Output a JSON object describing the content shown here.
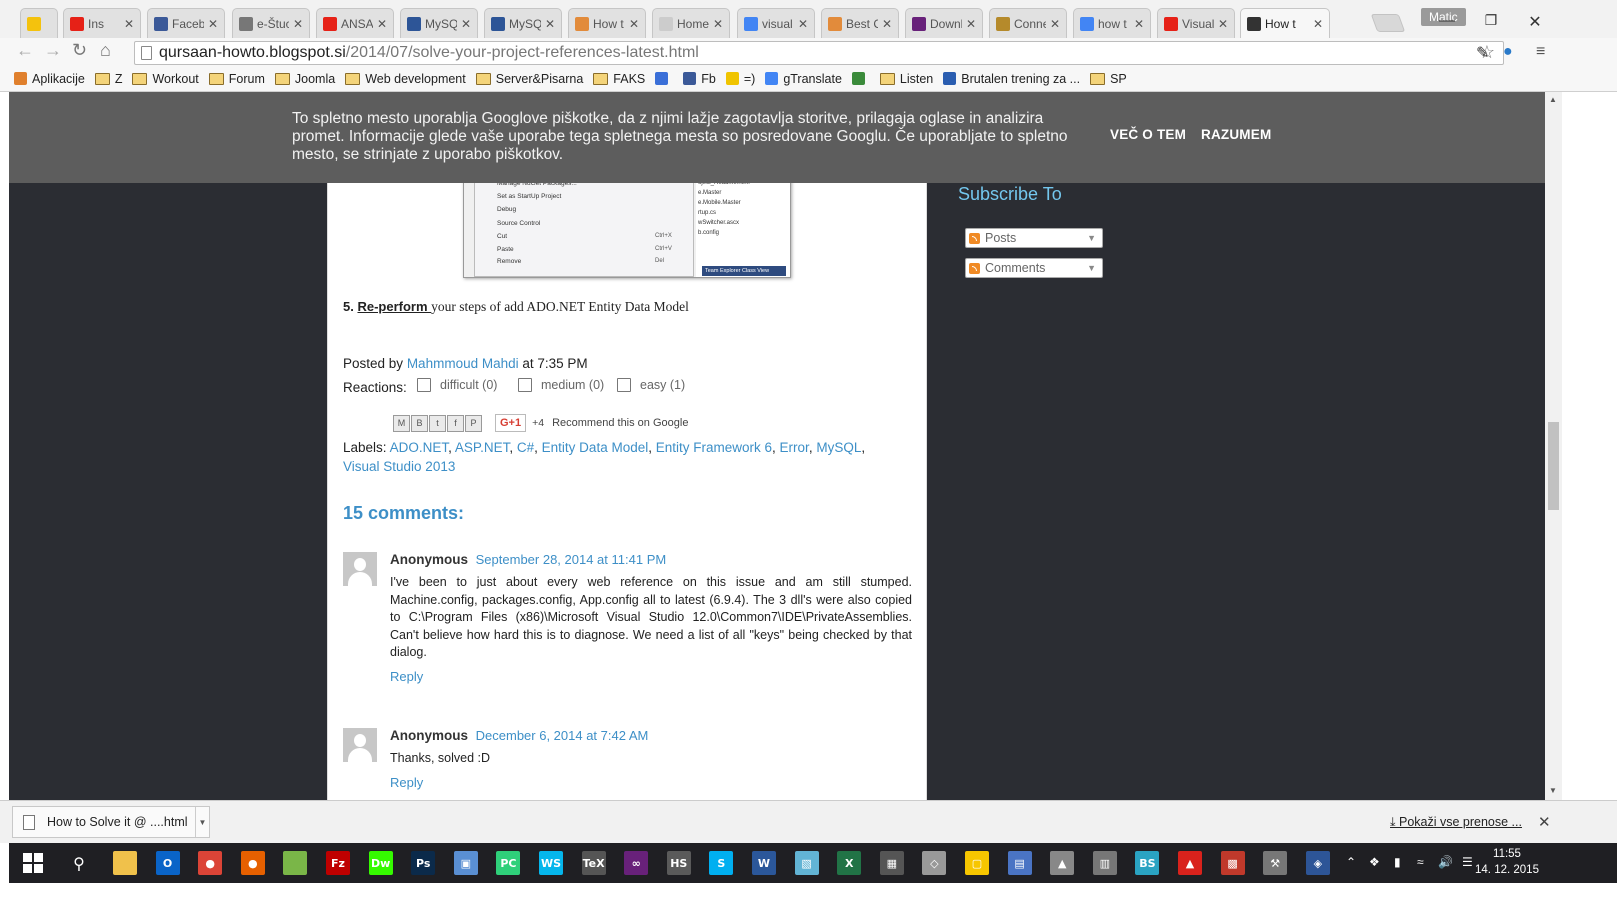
{
  "browser": {
    "tabs": [
      {
        "label": "",
        "icon": "keep-icon",
        "color": "#f4c20d"
      },
      {
        "label": "Ins",
        "icon": "youtube-icon",
        "color": "#e62117",
        "audio": true
      },
      {
        "label": "Faceb",
        "icon": "facebook-icon",
        "color": "#3b5998"
      },
      {
        "label": "e-Štuc",
        "icon": "moodle-icon",
        "color": "#777777"
      },
      {
        "label": "ANSA",
        "icon": "youtube-icon",
        "color": "#e62117"
      },
      {
        "label": "MySQ",
        "icon": "vs-icon",
        "color": "#2d5597"
      },
      {
        "label": "MySQ",
        "icon": "vs-icon",
        "color": "#2d5597"
      },
      {
        "label": "How t",
        "icon": "blogger-icon",
        "color": "#e28b3b"
      },
      {
        "label": "Home",
        "icon": "page-icon",
        "color": "#cccccc"
      },
      {
        "label": "visual",
        "icon": "google-icon",
        "color": "#4285f4"
      },
      {
        "label": "Best C",
        "icon": "blogger-icon",
        "color": "#e28b3b"
      },
      {
        "label": "Downl",
        "icon": "vs-purple-icon",
        "color": "#68217a"
      },
      {
        "label": "Conne",
        "icon": "connect-icon",
        "color": "#b58a2b"
      },
      {
        "label": "how t",
        "icon": "google-icon",
        "color": "#4285f4"
      },
      {
        "label": "Visual",
        "icon": "youtube-icon",
        "color": "#e62117"
      },
      {
        "label": "How t",
        "icon": "how-icon",
        "color": "#333333",
        "active": true
      }
    ],
    "profile": "Matic",
    "url_host": "qursaan-howto.blogspot.si",
    "url_path": "/2014/07/solve-your-project-references-latest.html",
    "bookmarks": [
      {
        "label": "Aplikacije",
        "icon": "apps-icon"
      },
      {
        "label": "Z",
        "icon": "folder-icon"
      },
      {
        "label": "Workout",
        "icon": "folder-icon"
      },
      {
        "label": "Forum",
        "icon": "folder-icon"
      },
      {
        "label": "Joomla",
        "icon": "folder-icon"
      },
      {
        "label": "Web development",
        "icon": "folder-icon"
      },
      {
        "label": "Server&Pisarna",
        "icon": "folder-icon"
      },
      {
        "label": "FAKS",
        "icon": "folder-icon"
      },
      {
        "label": "",
        "icon": "calendar-icon"
      },
      {
        "label": "Fb",
        "icon": "facebook-icon"
      },
      {
        "label": "=)",
        "icon": "smile-icon"
      },
      {
        "label": "gTranslate",
        "icon": "translate-icon"
      },
      {
        "label": "",
        "icon": "chart-icon"
      },
      {
        "label": "Listen",
        "icon": "folder-icon"
      },
      {
        "label": "Brutalen trening za ...",
        "icon": "runner-icon"
      },
      {
        "label": "SP",
        "icon": "folder-icon"
      }
    ]
  },
  "cookie": {
    "message": "To spletno mesto uporablja Googlove piškotke, da z njimi lažje zagotavlja storitve, prilagaja oglase in analizira promet. Informacije glede vaše uporabe tega spletnega mesta so posredovane Googlu. Če uporabljate to spletno mesto, se strinjate z uporabo piškotkov.",
    "more": "VEČ O TEM",
    "accept": "RAZUMEM"
  },
  "screenshot_menu": {
    "items": [
      "Manage NuGet Packages...",
      "Set as StartUp Project",
      "Debug",
      "Source Control",
      "Cut",
      "Paste",
      "Remove"
    ],
    "shortcuts": [
      "Ctrl+X",
      "Ctrl+V",
      "Del"
    ],
    "files": [
      "oject_Readme.html",
      "e.Master",
      "e.Mobile.Master",
      "rtup.cs",
      "wSwitcher.ascx",
      "b.config"
    ],
    "tabs": "Team Explorer   Class View"
  },
  "post": {
    "step_num": "5.",
    "step_link": "Re-perform ",
    "step_text": "your steps of add ADO.NET Entity Data Model",
    "posted_by": "Posted by",
    "author": "Mahmmoud Mahdi",
    "at": "at",
    "time": "7:35 PM",
    "reactions_label": "Reactions:",
    "reactions": [
      "difficult (0)",
      "medium (0)",
      "easy (1)"
    ],
    "gplus": "G+1",
    "gplus_count": "+4",
    "gplus_rec": "Recommend this on Google",
    "labels_prefix": "Labels:",
    "labels": [
      "ADO.NET",
      "ASP.NET",
      "C#",
      "Entity Data Model",
      "Entity Framework 6",
      "Error",
      "MySQL",
      "Visual Studio 2013"
    ],
    "comments_title": "15 comments:",
    "comments": [
      {
        "author": "Anonymous",
        "date": "September 28, 2014 at 11:41 PM",
        "text": "I've been to just about every web reference on this issue and am still stumped. Machine.config, packages.config, App.config all to latest (6.9.4). The 3 dll's were also copied to C:\\Program Files (x86)\\Microsoft Visual Studio 12.0\\Common7\\IDE\\PrivateAssemblies. Can't believe how hard this is to diagnose. We need a list of all \"keys\" being checked by that dialog.",
        "reply": "Reply"
      },
      {
        "author": "Anonymous",
        "date": "December 6, 2014 at 7:42 AM",
        "text": "Thanks, solved :D",
        "reply": "Reply"
      }
    ]
  },
  "sidebar": {
    "title": "Subscribe To",
    "posts": "Posts",
    "comments": "Comments"
  },
  "download": {
    "filename": "How to Solve it @ ....html",
    "show_all": "Pokaži vse prenose ..."
  },
  "taskbar": {
    "time": "11:55",
    "date": "14. 12. 2015"
  }
}
